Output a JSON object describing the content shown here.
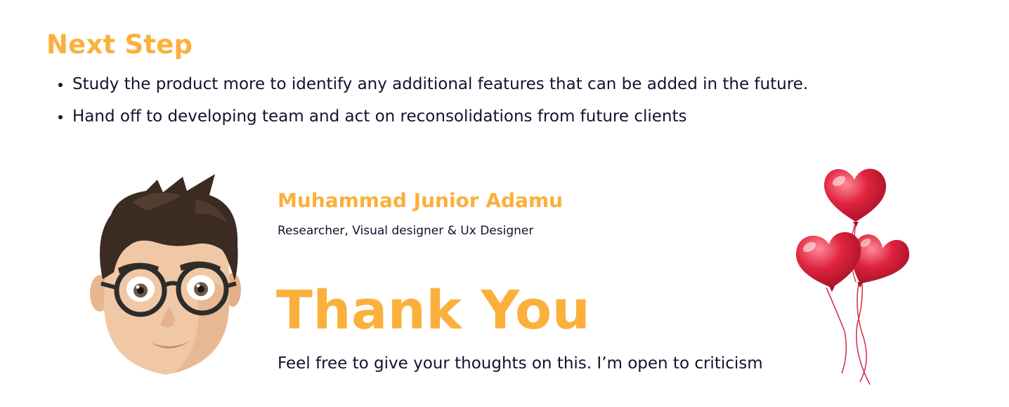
{
  "next_step": {
    "title": "Next Step",
    "items": [
      "Study the product more to identify any additional features that can be added in the future.",
      "Hand off to developing team and act on reconsolidations from future clients"
    ]
  },
  "profile": {
    "name": "Muhammad Junior Adamu",
    "role": "Researcher, Visual designer & Ux Designer",
    "avatar_icon": "memoji-avatar"
  },
  "closing": {
    "thank_you": "Thank You",
    "message": "Feel free to give your thoughts on this. I’m open to criticism",
    "decoration_icon": "heart-balloons"
  },
  "colors": {
    "accent": "#fbb03b",
    "text": "#14122b",
    "balloon": "#d61f3a"
  }
}
